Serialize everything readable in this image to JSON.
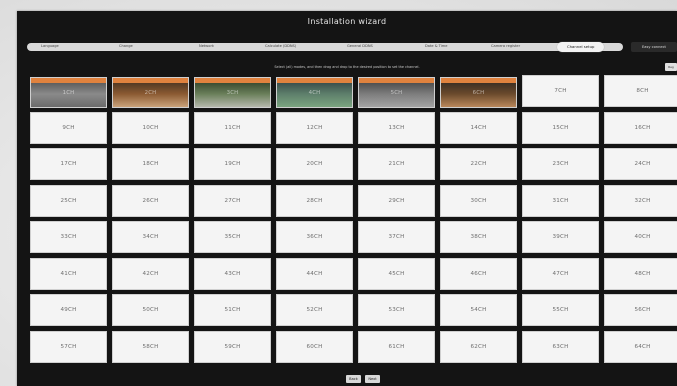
{
  "window": {
    "title": "Installation wizard"
  },
  "steps": [
    {
      "label": "Language"
    },
    {
      "label": "Change"
    },
    {
      "label": "Network"
    },
    {
      "label": "Calculate (DDNS)"
    },
    {
      "label": "General DDNS"
    },
    {
      "label": "Date & Time"
    },
    {
      "label": "Camera register"
    },
    {
      "label": "Channel setup"
    }
  ],
  "current_tab": "Easy connect",
  "corner_button": "Reg",
  "instruction": "Select (all) modes, and then drag and drop to the desired position to set the channel.",
  "channels": [
    "1CH",
    "2CH",
    "3CH",
    "4CH",
    "5CH",
    "6CH",
    "7CH",
    "8CH",
    "9CH",
    "10CH",
    "11CH",
    "12CH",
    "13CH",
    "14CH",
    "15CH",
    "16CH",
    "17CH",
    "18CH",
    "19CH",
    "20CH",
    "21CH",
    "22CH",
    "23CH",
    "24CH",
    "25CH",
    "26CH",
    "27CH",
    "28CH",
    "29CH",
    "30CH",
    "31CH",
    "32CH",
    "33CH",
    "34CH",
    "35CH",
    "36CH",
    "37CH",
    "38CH",
    "39CH",
    "40CH",
    "41CH",
    "42CH",
    "43CH",
    "44CH",
    "45CH",
    "46CH",
    "47CH",
    "48CH",
    "49CH",
    "50CH",
    "51CH",
    "52CH",
    "53CH",
    "54CH",
    "55CH",
    "56CH",
    "57CH",
    "58CH",
    "59CH",
    "60CH",
    "61CH",
    "62CH",
    "63CH",
    "64CH"
  ],
  "colors": {
    "window_bg": "#141414",
    "cell_bg": "#f4f4f4",
    "camera_bar": "#e0823e",
    "text_light": "#e6e6e6"
  },
  "footer": {
    "back_label": "Back",
    "next_label": "Next"
  }
}
